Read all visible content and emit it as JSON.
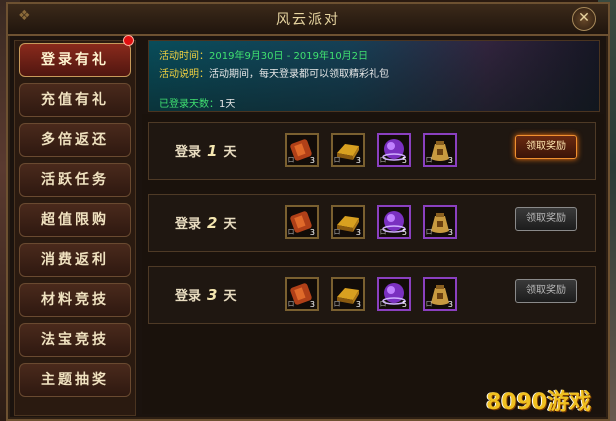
{
  "window": {
    "title": "风云派对",
    "close_glyph": "✕"
  },
  "sidebar": {
    "items": [
      {
        "label": "登录有礼",
        "active": true
      },
      {
        "label": "充值有礼",
        "active": false
      },
      {
        "label": "多倍返还",
        "active": false
      },
      {
        "label": "活跃任务",
        "active": false
      },
      {
        "label": "超值限购",
        "active": false
      },
      {
        "label": "消费返利",
        "active": false
      },
      {
        "label": "材料竞技",
        "active": false
      },
      {
        "label": "法宝竞技",
        "active": false
      },
      {
        "label": "主题抽奖",
        "active": false
      }
    ]
  },
  "banner": {
    "time_label": "活动时间：",
    "time_value": "2019年9月30日 - 2019年10月2日",
    "desc_label": "活动说明：",
    "desc_value": "活动期间，每天登录都可以领取精彩礼包",
    "days_label": "已登录天数：",
    "days_value": "1天"
  },
  "rows": [
    {
      "prefix": "登录",
      "day": "1",
      "suffix": "天",
      "button": "领取奖励",
      "claimable": true
    },
    {
      "prefix": "登录",
      "day": "2",
      "suffix": "天",
      "button": "领取奖励",
      "claimable": false
    },
    {
      "prefix": "登录",
      "day": "3",
      "suffix": "天",
      "button": "领取奖励",
      "claimable": false
    }
  ],
  "reward_items": [
    {
      "icon": "red-scroll-icon",
      "count": "3"
    },
    {
      "icon": "gold-ingot-icon",
      "count": "3"
    },
    {
      "icon": "purple-orb-icon",
      "count": "5"
    },
    {
      "icon": "treasure-bag-icon",
      "count": "3"
    }
  ],
  "watermark": "8090游戏"
}
